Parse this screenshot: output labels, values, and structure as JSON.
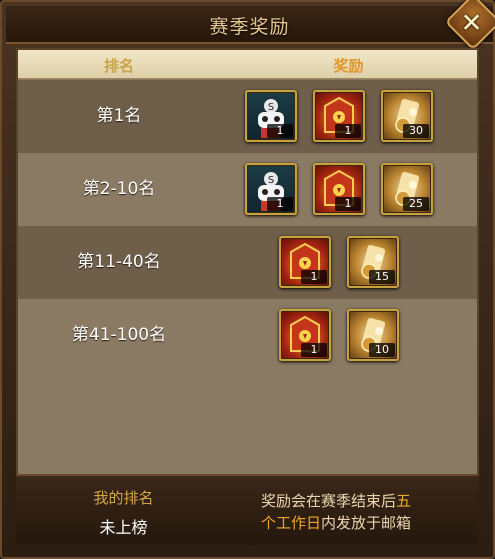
{
  "dialog": {
    "title": "赛季奖励"
  },
  "table": {
    "headers": {
      "rank": "排名",
      "reward": "奖励"
    },
    "rows": [
      {
        "rank": "第1名",
        "rewards": [
          {
            "icon": "warrior-mask-icon",
            "qty": "1"
          },
          {
            "icon": "treasure-chest-icon",
            "qty": "1"
          },
          {
            "icon": "golden-scroll-icon",
            "qty": "30"
          }
        ]
      },
      {
        "rank": "第2-10名",
        "rewards": [
          {
            "icon": "warrior-mask-icon",
            "qty": "1"
          },
          {
            "icon": "treasure-chest-icon",
            "qty": "1"
          },
          {
            "icon": "golden-scroll-icon",
            "qty": "25"
          }
        ]
      },
      {
        "rank": "第11-40名",
        "rewards": [
          {
            "icon": "treasure-chest-icon",
            "qty": "1"
          },
          {
            "icon": "golden-scroll-icon",
            "qty": "15"
          }
        ]
      },
      {
        "rank": "第41-100名",
        "rewards": [
          {
            "icon": "treasure-chest-icon",
            "qty": "1"
          },
          {
            "icon": "golden-scroll-icon",
            "qty": "10"
          }
        ]
      }
    ]
  },
  "footer": {
    "my_rank_label": "我的排名",
    "my_rank_value": "未上榜",
    "notice_part1": "奖励会在赛季结束后",
    "notice_highlight1": "五",
    "notice_highlight2": "个工作日",
    "notice_part2": "内发放于邮箱"
  },
  "colors": {
    "accent": "#f0a624",
    "header_text": "#c9a44a",
    "frame": "#6a4a2a"
  }
}
